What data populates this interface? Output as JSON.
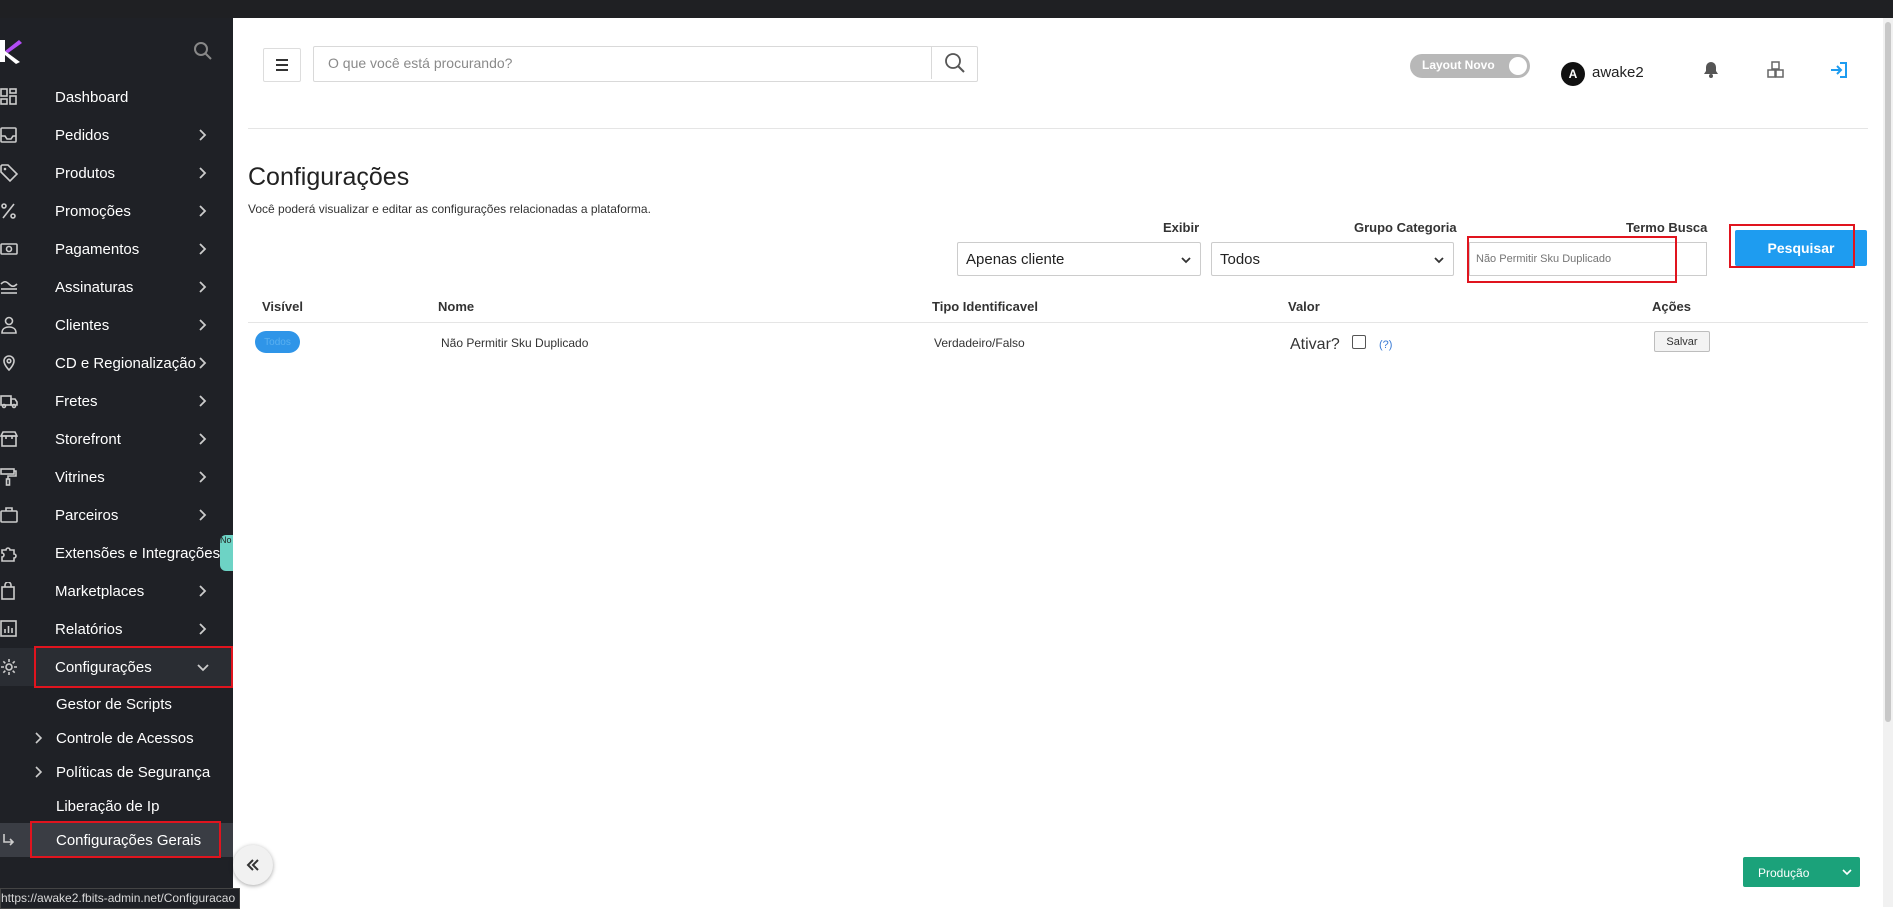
{
  "sidebar": {
    "items": [
      {
        "label": "Dashboard",
        "icon": "dashboard-icon"
      },
      {
        "label": "Pedidos",
        "icon": "inbox-icon"
      },
      {
        "label": "Produtos",
        "icon": "tag-icon"
      },
      {
        "label": "Promoções",
        "icon": "percent-icon"
      },
      {
        "label": "Pagamentos",
        "icon": "money-icon"
      },
      {
        "label": "Assinaturas",
        "icon": "subscription-icon"
      },
      {
        "label": "Clientes",
        "icon": "user-icon"
      },
      {
        "label": "CD e Regionalização",
        "icon": "location-icon"
      },
      {
        "label": "Fretes",
        "icon": "truck-icon"
      },
      {
        "label": "Storefront",
        "icon": "store-icon"
      },
      {
        "label": "Vitrines",
        "icon": "paint-roller-icon"
      },
      {
        "label": "Parceiros",
        "icon": "briefcase-icon"
      },
      {
        "label": "Extensões e Integrações",
        "icon": "puzzle-icon"
      },
      {
        "label": "Marketplaces",
        "icon": "shopping-bag-icon"
      },
      {
        "label": "Relatórios",
        "icon": "report-icon"
      },
      {
        "label": "Configurações",
        "icon": "gear-icon"
      }
    ],
    "subitems": [
      {
        "label": "Gestor de Scripts"
      },
      {
        "label": "Controle de Acessos"
      },
      {
        "label": "Políticas de Segurança"
      },
      {
        "label": "Liberação de Ip"
      },
      {
        "label": "Configurações Gerais"
      }
    ],
    "teal_tab_text": "No",
    "status_url": "https://awake2.fbits-admin.net/Configuracao"
  },
  "header": {
    "search_placeholder": "O que você está procurando?",
    "layout_toggle_label": "Layout Novo",
    "avatar_initial": "A",
    "username": "awake2"
  },
  "page": {
    "title": "Configurações",
    "description": "Você poderá visualizar e editar as configurações relacionadas a plataforma."
  },
  "filters": {
    "exibir_label": "Exibir",
    "exibir_value": "Apenas cliente",
    "grupo_label": "Grupo Categoria",
    "grupo_value": "Todos",
    "termo_label": "Termo Busca",
    "termo_placeholder": "Não Permitir Sku Duplicado",
    "search_button": "Pesquisar"
  },
  "table": {
    "headers": {
      "visivel": "Visível",
      "nome": "Nome",
      "tipo": "Tipo Identificavel",
      "valor": "Valor",
      "acoes": "Ações"
    },
    "rows": [
      {
        "visivel": "Todos",
        "nome": "Não Permitir Sku Duplicado",
        "tipo": "Verdadeiro/Falso",
        "valor_label": "Ativar?",
        "valor_checked": false,
        "help": "(?)",
        "action": "Salvar"
      }
    ]
  },
  "footer": {
    "environment": "Produção"
  },
  "colors": {
    "sidebar_bg": "#1f2126",
    "primary": "#1e9cf0",
    "env": "#1ba27a",
    "highlight": "#e0141e"
  }
}
